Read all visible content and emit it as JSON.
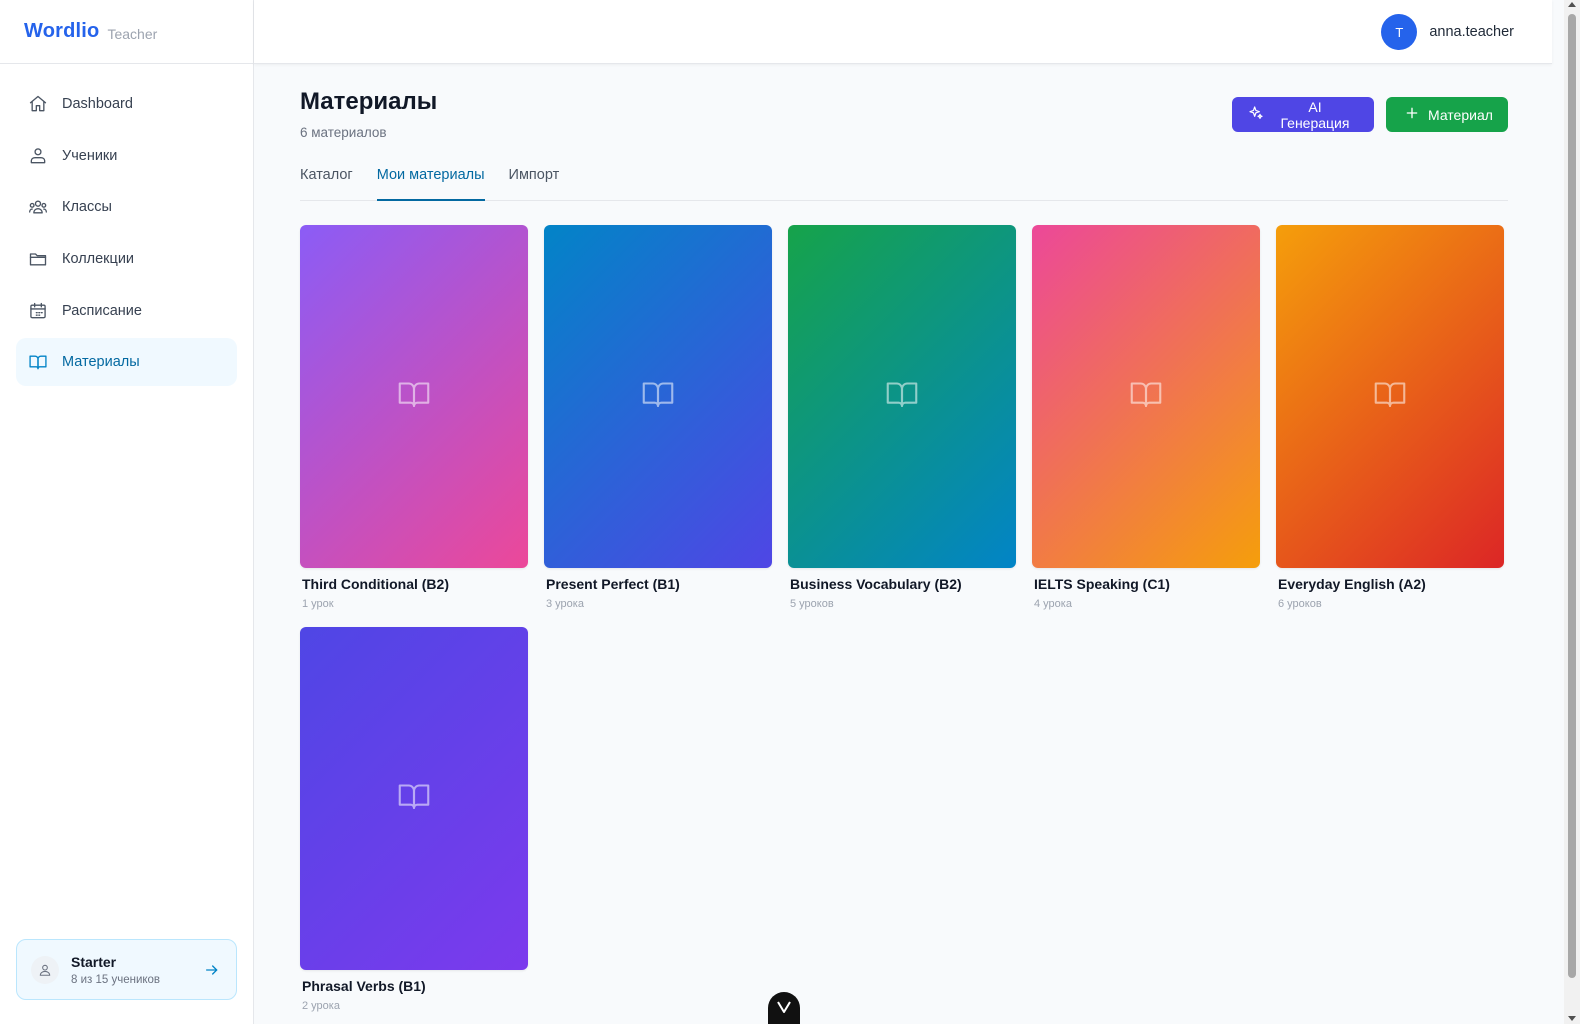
{
  "brand": {
    "name": "Wordlio",
    "role": "Teacher"
  },
  "sidebar": {
    "items": [
      {
        "label": "Dashboard",
        "icon": "home-icon"
      },
      {
        "label": "Ученики",
        "icon": "students-icon"
      },
      {
        "label": "Классы",
        "icon": "classes-icon"
      },
      {
        "label": "Коллекции",
        "icon": "folder-icon"
      },
      {
        "label": "Расписание",
        "icon": "calendar-icon"
      },
      {
        "label": "Материалы",
        "icon": "book-icon",
        "active": true
      }
    ],
    "plan": {
      "name": "Starter",
      "usage": "8 из 15 учеников"
    }
  },
  "header": {
    "avatar_letter": "T",
    "username": "anna.teacher"
  },
  "page": {
    "title": "Материалы",
    "subtitle": "6 материалов",
    "ai_button": "AI Генерация",
    "add_button": "Материал"
  },
  "tabs": [
    {
      "label": "Каталог"
    },
    {
      "label": "Мои материалы",
      "active": true
    },
    {
      "label": "Импорт"
    }
  ],
  "materials": [
    {
      "title": "Third Conditional (B2)",
      "meta": "1 урок",
      "gradient": [
        "#8b5cf6",
        "#ec4899"
      ]
    },
    {
      "title": "Present Perfect (B1)",
      "meta": "3 урока",
      "gradient": [
        "#0284c7",
        "#4f46e5"
      ]
    },
    {
      "title": "Business Vocabulary (B2)",
      "meta": "5 уроков",
      "gradient": [
        "#16a34a",
        "#0284c7"
      ]
    },
    {
      "title": "IELTS Speaking (C1)",
      "meta": "4 урока",
      "gradient": [
        "#ec4899",
        "#f59e0b"
      ]
    },
    {
      "title": "Everyday English (A2)",
      "meta": "6 уроков",
      "gradient": [
        "#f59e0b",
        "#dc2626"
      ]
    },
    {
      "title": "Phrasal Verbs (B1)",
      "meta": "2 урока",
      "gradient": [
        "#4f46e5",
        "#7c3aed"
      ]
    }
  ],
  "colors": {
    "brand": "#2563eb",
    "active_tab": "#0369a1",
    "ai_button": "#4f46e5",
    "add_button": "#16a34a"
  }
}
